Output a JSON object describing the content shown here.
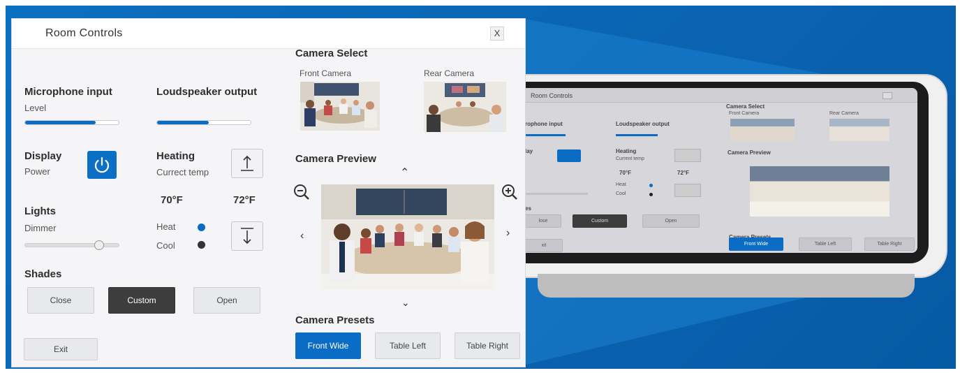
{
  "window": {
    "title": "Room Controls",
    "close_label": "X"
  },
  "microphone": {
    "label": "Microphone input",
    "sublabel": "Level",
    "level": 0.75
  },
  "loudspeaker": {
    "label": "Loudspeaker output",
    "level": 0.55
  },
  "display": {
    "label": "Display",
    "sublabel": "Power",
    "icon": "power-icon"
  },
  "heating": {
    "label": "Heating",
    "sublabel": "Currect temp",
    "current_temp": "70°F",
    "set_temp": "72°F",
    "heat_label": "Heat",
    "cool_label": "Cool",
    "up_icon": "arrow-up-icon",
    "down_icon": "arrow-down-icon"
  },
  "lights": {
    "label": "Lights",
    "sublabel": "Dimmer",
    "level": 0.78
  },
  "shades": {
    "label": "Shades",
    "buttons": [
      "Close",
      "Custom",
      "Open"
    ],
    "selected": "Custom"
  },
  "exit_label": "Exit",
  "camera_select": {
    "label": "Camera Select",
    "front_label": "Front Camera",
    "rear_label": "Rear Camera"
  },
  "camera_preview": {
    "label": "Camera Preview"
  },
  "camera_presets": {
    "label": "Camera Presets",
    "buttons": [
      "Front Wide",
      "Table Left",
      "Table Right"
    ],
    "selected": "Front Wide"
  },
  "colors": {
    "accent": "#0a6cc4",
    "background": "#0b6fbf",
    "dark_button": "#3d3d3d"
  },
  "tablet": {
    "title": "Room Controls",
    "mic_label": "rophone input",
    "speaker_label": "Loudspeaker output",
    "display_label": "lay",
    "heating_label": "Heating",
    "heating_sub": "Current temp",
    "temp_a": "70°F",
    "temp_b": "72°F",
    "heat": "Heat",
    "cool": "Cool",
    "shades_label": "es",
    "custom_label": "Custom",
    "close_label": "lose",
    "open_label": "Open",
    "exit_label": "xit",
    "camera_select": "Camera Select",
    "front_camera": "Front Camera",
    "rear_camera": "Rear Camera",
    "camera_preview": "Camera Preview",
    "camera_presets": "Camera Presets",
    "preset_front": "Front Wide",
    "preset_left": "Table Left",
    "preset_right": "Table Right"
  }
}
